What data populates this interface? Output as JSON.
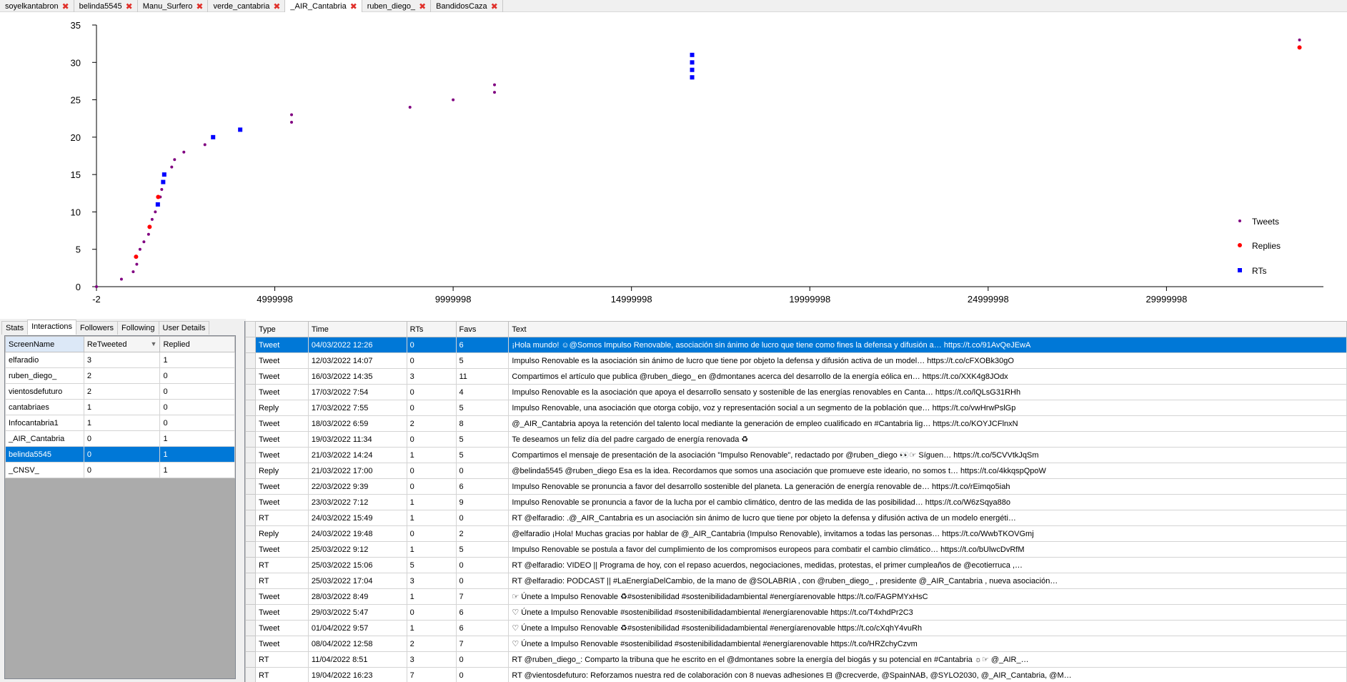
{
  "tabs": [
    {
      "label": "soyelkantabron",
      "active": false
    },
    {
      "label": "belinda5545",
      "active": false
    },
    {
      "label": "Manu_Surfero",
      "active": false
    },
    {
      "label": "verde_cantabria",
      "active": false
    },
    {
      "label": "_AIR_Cantabria",
      "active": true
    },
    {
      "label": "ruben_diego_",
      "active": false
    },
    {
      "label": "BandidosCaza",
      "active": false
    }
  ],
  "tab_close_icon": "close-icon",
  "chart_data": {
    "type": "scatter",
    "xlim": [
      -2,
      34400000
    ],
    "ylim": [
      0,
      35
    ],
    "x_ticks": [
      -2,
      4999998,
      9999998,
      14999998,
      19999998,
      24999998,
      29999998
    ],
    "x_tick_labels": [
      "-2",
      "4999998",
      "9999998",
      "14999998",
      "19999998",
      "24999998",
      "29999998"
    ],
    "y_ticks": [
      0,
      5,
      10,
      15,
      20,
      25,
      30,
      35
    ],
    "y_tick_labels": [
      "0",
      "5",
      "10",
      "15",
      "20",
      "25",
      "30",
      "35"
    ],
    "grid": false,
    "legend_position": "right",
    "series": [
      {
        "name": "Tweets",
        "color": "#800080",
        "marker": "dot",
        "points": [
          [
            0,
            0
          ],
          [
            700000,
            1
          ],
          [
            1030000,
            2
          ],
          [
            1130000,
            3
          ],
          [
            1220000,
            5
          ],
          [
            1330000,
            6
          ],
          [
            1460000,
            7
          ],
          [
            1560000,
            9
          ],
          [
            1650000,
            10
          ],
          [
            1790000,
            12
          ],
          [
            1830000,
            13
          ],
          [
            2110000,
            16
          ],
          [
            2190000,
            17
          ],
          [
            2450000,
            18
          ],
          [
            3040000,
            19
          ],
          [
            5470000,
            22
          ],
          [
            5470000,
            23
          ],
          [
            8790000,
            24
          ],
          [
            10000000,
            25
          ],
          [
            11160000,
            26
          ],
          [
            11160000,
            27
          ],
          [
            33730000,
            33
          ]
        ]
      },
      {
        "name": "Replies",
        "color": "#ff0000",
        "marker": "circle",
        "points": [
          [
            1110000,
            4
          ],
          [
            1490000,
            8
          ],
          [
            1730000,
            12
          ],
          [
            33730000,
            32
          ]
        ]
      },
      {
        "name": "RTs",
        "color": "#0000ff",
        "marker": "square",
        "points": [
          [
            1720000,
            11
          ],
          [
            1870000,
            14
          ],
          [
            1900000,
            15
          ],
          [
            3270000,
            20
          ],
          [
            4030000,
            21
          ],
          [
            16700000,
            28
          ],
          [
            16700000,
            29
          ],
          [
            16700000,
            30
          ],
          [
            16700000,
            31
          ]
        ]
      }
    ]
  },
  "left_panel": {
    "subtabs": [
      "Stats",
      "Interactions",
      "Followers",
      "Following",
      "User Details"
    ],
    "active_subtab": 1,
    "columns": [
      "ScreenName",
      "ReTweeted",
      "Replied"
    ],
    "sort_icon": "sort-down-icon",
    "rows": [
      [
        "elfaradio",
        "3",
        "1"
      ],
      [
        "ruben_diego_",
        "2",
        "0"
      ],
      [
        "vientosdefuturo",
        "2",
        "0"
      ],
      [
        "cantabriaes",
        "1",
        "0"
      ],
      [
        "Infocantabria1",
        "1",
        "0"
      ],
      [
        "_AIR_Cantabria",
        "0",
        "1"
      ],
      [
        "belinda5545",
        "0",
        "1"
      ],
      [
        "_CNSV_",
        "0",
        "1"
      ]
    ],
    "selected_row": 6
  },
  "tweets_grid": {
    "columns": [
      "Type",
      "Time",
      "RTs",
      "Favs",
      "Text"
    ],
    "selected_row": 0,
    "rows": [
      [
        "Tweet",
        "04/03/2022 12:26",
        "0",
        "6",
        "¡Hola mundo! ☺@Somos Impulso Renovable, asociación sin ánimo de lucro que tiene como fines la defensa y difusión a… https://t.co/91AvQeJEwA"
      ],
      [
        "Tweet",
        "12/03/2022 14:07",
        "0",
        "5",
        "Impulso Renovable es la asociación sin ánimo de lucro que tiene por objeto la defensa y difusión activa de un model… https://t.co/cFXOBk30gO"
      ],
      [
        "Tweet",
        "16/03/2022 14:35",
        "3",
        "11",
        "Compartimos el artículo que publica @ruben_diego_ en @dmontanes acerca del desarrollo de la energía eólica en… https://t.co/XXK4g8JOdx"
      ],
      [
        "Tweet",
        "17/03/2022 7:54",
        "0",
        "4",
        "Impulso Renovable es la asociación que apoya el desarrollo sensato y sostenible de las energías renovables en Canta… https://t.co/lQLsG31RHh"
      ],
      [
        "Reply",
        "17/03/2022 7:55",
        "0",
        "5",
        "Impulso Renovable, una asociación que otorga cobijo, voz y representación social a un segmento de la población  que… https://t.co/vwHrwPslGp"
      ],
      [
        "Tweet",
        "18/03/2022 6:59",
        "2",
        "8",
        "@_AIR_Cantabria apoya la retención del talento local mediante la generación de empleo cualificado en #Cantabria lig… https://t.co/KOYJCFlnxN"
      ],
      [
        "Tweet",
        "19/03/2022 11:34",
        "0",
        "5",
        "Te deseamos un feliz día del padre cargado de energía renovada ♻"
      ],
      [
        "Tweet",
        "21/03/2022 14:24",
        "1",
        "5",
        "Compartimos el mensaje de presentación de la asociación \"Impulso Renovable\", redactado por @ruben_diego 👀☞ Síguen… https://t.co/5CVVtkJqSm"
      ],
      [
        "Reply",
        "21/03/2022 17:00",
        "0",
        "0",
        "@belinda5545 @ruben_diego Esa es la idea. Recordamos que somos una asociación que promueve este ideario, no somos t… https://t.co/4kkqspQpoW"
      ],
      [
        "Tweet",
        "22/03/2022 9:39",
        "0",
        "6",
        "Impulso Renovable se pronuncia a favor del desarrollo sostenible del planeta. La generación de energía renovable de… https://t.co/rEimqo5iah"
      ],
      [
        "Tweet",
        "23/03/2022 7:12",
        "1",
        "9",
        "Impulso Renovable se pronuncia a favor de la lucha por el cambio climático, dentro de las medida de las posibilidad… https://t.co/W6zSqya88o"
      ],
      [
        "RT",
        "24/03/2022 15:49",
        "1",
        "0",
        "RT @elfaradio: .@_AIR_Cantabria es un asociación sin ánimo de lucro que tiene por objeto la defensa y difusión activa de un modelo energéti…"
      ],
      [
        "Reply",
        "24/03/2022 19:48",
        "0",
        "2",
        "@elfaradio ¡Hola! Muchas gracias por hablar de @_AIR_Cantabria (Impulso Renovable), invitamos a todas las personas… https://t.co/WwbTKOVGmj"
      ],
      [
        "Tweet",
        "25/03/2022 9:12",
        "1",
        "5",
        "Impulso Renovable se postula a favor del cumplimiento de los compromisos europeos para combatir el cambio climático… https://t.co/bUlwcDvRfM"
      ],
      [
        "RT",
        "25/03/2022 15:06",
        "5",
        "0",
        "RT @elfaradio: VIDEO || Programa de hoy, con el repaso acuerdos, negociaciones, medidas, protestas, el primer cumpleaños de @ecotierruca ,…"
      ],
      [
        "RT",
        "25/03/2022 17:04",
        "3",
        "0",
        "RT @elfaradio: PODCAST || #LaEnergíaDelCambio, de la mano de @SOLABRIA , con @ruben_diego_ , presidente @_AIR_Cantabria , nueva asociación…"
      ],
      [
        "Tweet",
        "28/03/2022 8:49",
        "1",
        "7",
        "☞ Únete a Impulso Renovable ♻#sostenibilidad #sostenibilidadambiental #energíarenovable https://t.co/FAGPMYxHsC"
      ],
      [
        "Tweet",
        "29/03/2022 5:47",
        "0",
        "6",
        "♡ Únete a Impulso Renovable #sostenibilidad #sostenibilidadambiental #energíarenovable https://t.co/T4xhdPr2C3"
      ],
      [
        "Tweet",
        "01/04/2022 9:57",
        "1",
        "6",
        "♡ Únete a Impulso Renovable ♻#sostenibilidad #sostenibilidadambiental #energíarenovable https://t.co/cXqhY4vuRh"
      ],
      [
        "Tweet",
        "08/04/2022 12:58",
        "2",
        "7",
        "♡ Únete a Impulso Renovable #sostenibilidad #sostenibilidadambiental #energíarenovable https://t.co/HRZchyCzvm"
      ],
      [
        "RT",
        "11/04/2022 8:51",
        "3",
        "0",
        "RT @ruben_diego_: Comparto la tribuna que he escrito en el @dmontanes sobre la energía del biogás y su potencial en #Cantabria ☼☞ @_AIR_…"
      ],
      [
        "RT",
        "19/04/2022 16:23",
        "7",
        "0",
        "RT @vientosdefuturo: Reforzamos nuestra red de colaboración con 8 nuevas adhesiones ⊟ @crecverde, @SpainNAB, @SYLO2030, @_AIR_Cantabria, @M…"
      ]
    ]
  }
}
